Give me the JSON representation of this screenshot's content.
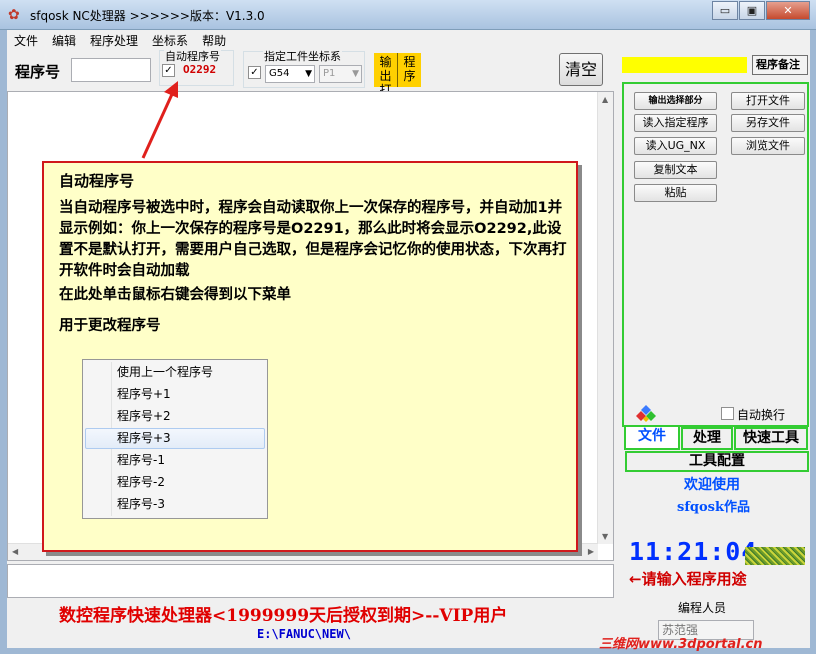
{
  "window": {
    "title": "sfqosk NC处理器  >>>>>>版本：V1.3.0",
    "minimize": "▭",
    "maximize": "▣",
    "close": "✕"
  },
  "menu": [
    "文件",
    "编辑",
    "程序处理",
    "坐标系",
    "帮助"
  ],
  "toolbar": {
    "program_label": "程序号",
    "program_value": "",
    "auto_group_label": "自动程序号",
    "auto_checked": "✓",
    "auto_number": "O2292",
    "coord_group_label": "指定工件坐标系",
    "coord_checked": "✓",
    "coord_value": "G54",
    "p_value": "P1",
    "output_col1": "输出\n打开",
    "output_col2": "程\n序",
    "clear_label": "清空"
  },
  "right_panel": {
    "notes_button": "程序备注",
    "buttons": {
      "output_selection": "输出选择部分",
      "open_file": "打开文件",
      "read_specified": "读入指定程序",
      "save_as": "另存文件",
      "read_ug": "读入UG_NX",
      "browse_files": "浏览文件",
      "copy_text": "复制文本",
      "paste": "粘贴"
    },
    "auto_wrap_label": "自动换行",
    "tabs": [
      "文件",
      "处理",
      "快速工具"
    ],
    "tool_config": "工具配置",
    "welcome_line1": "欢迎使用",
    "welcome_line2": "sfqosk作品",
    "clock": "11:21:04",
    "purpose_hint": "←请输入程序用途",
    "coder_label": "编程人员",
    "coder_value": "苏范强"
  },
  "footer": {
    "title": "数控程序快速处理器<1999999天后授权到期>--VIP用户",
    "path": "E:\\FANUC\\NEW\\"
  },
  "callout": {
    "title": "自动程序号",
    "body": "当自动程序号被选中时，程序会自动读取你上一次保存的程序号，并自动加1并显示例如：你上一次保存的程序号是O2291，那么此时将会显示O2292,此设置不是默认打开，需要用户自己选取，但是程序会记忆你的使用状态，下次再打开软件时会自动加载",
    "para2": "在此处单击鼠标右键会得到以下菜单",
    "para3": "用于更改程序号",
    "context_menu": [
      "使用上一个程序号",
      "程序号+1",
      "程序号+2",
      "程序号+3",
      "程序号-1",
      "程序号-2",
      "程序号-3"
    ],
    "highlighted_item": "程序号+3"
  },
  "watermark": "三维网www.3dportal.cn",
  "colors": {
    "accent_yellow": "#ffff00",
    "output_button": "#ffd000",
    "green_border": "#33cc33",
    "red_text": "#d00000",
    "blue_text": "#0050ff",
    "callout_bg": "#ffffc8",
    "callout_border": "#d0181c"
  }
}
